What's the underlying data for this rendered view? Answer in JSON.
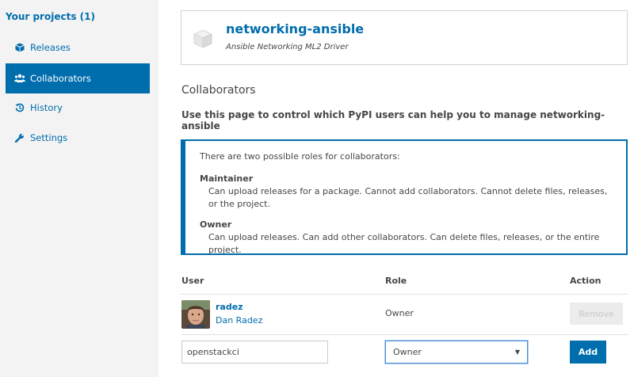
{
  "sidebar": {
    "title": "Your projects (1)",
    "items": [
      {
        "label": "Releases",
        "icon": "cube-icon"
      },
      {
        "label": "Collaborators",
        "icon": "users-icon"
      },
      {
        "label": "History",
        "icon": "history-icon"
      },
      {
        "label": "Settings",
        "icon": "wrench-icon"
      }
    ]
  },
  "project": {
    "name": "networking-ansible",
    "description": "Ansible Networking ML2 Driver"
  },
  "page": {
    "heading": "Collaborators",
    "subheading": "Use this page to control which PyPI users can help you to manage networking-ansible"
  },
  "callout": {
    "intro": "There are two possible roles for collaborators:",
    "roles": [
      {
        "name": "Maintainer",
        "description": "Can upload releases for a package. Cannot add collaborators. Cannot delete files, releases, or the project."
      },
      {
        "name": "Owner",
        "description": "Can upload releases. Can add other collaborators. Can delete files, releases, or the entire project."
      }
    ]
  },
  "table": {
    "headers": {
      "user": "User",
      "role": "Role",
      "action": "Action"
    },
    "rows": [
      {
        "username": "radez",
        "full_name": "Dan Radez",
        "role": "Owner",
        "action_label": "Remove"
      }
    ]
  },
  "add_form": {
    "username_value": "openstackci",
    "role_selected": "Owner",
    "add_label": "Add"
  },
  "colors": {
    "accent": "#006dad",
    "sidebar_bg": "#f3f3f3",
    "text": "#464646"
  }
}
